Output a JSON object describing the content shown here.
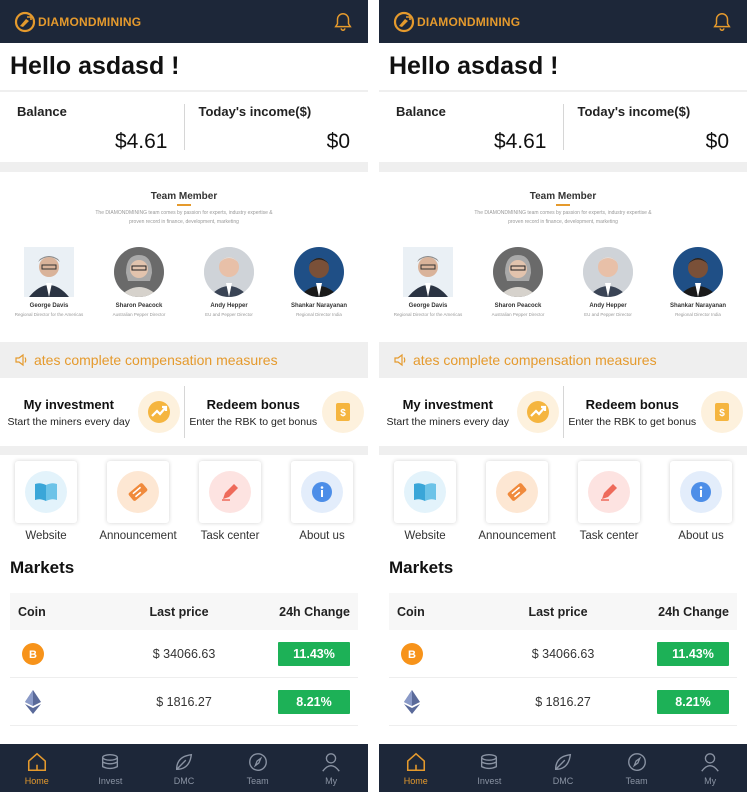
{
  "app": {
    "logo_text": "DIAMONDMINING"
  },
  "greeting": "Hello asdasd !",
  "balance": {
    "label": "Balance",
    "value": "$4.61"
  },
  "income": {
    "label": "Today's income($)",
    "value": "$0"
  },
  "team": {
    "title": "Team Member",
    "description": "The DIAMONDMINING team comes by passion for experts, industry expertise & proven record in finance, development, marketing",
    "members": [
      {
        "name": "George Davis",
        "role": "Regional Director for the Americas"
      },
      {
        "name": "Sharon Peacock",
        "role": "Australian Pepper Director"
      },
      {
        "name": "Andy Hepper",
        "role": "EU and Pepper Director"
      },
      {
        "name": "Shankar Narayanan",
        "role": "Regional Director India"
      }
    ]
  },
  "notice": {
    "text": "ates complete compensation measures",
    "icon": "speaker-icon"
  },
  "actions": {
    "investment": {
      "title": "My investment",
      "subtitle": "Start the miners every day"
    },
    "redeem": {
      "title": "Redeem bonus",
      "subtitle": "Enter the RBK to get bonus"
    }
  },
  "shortcuts": [
    {
      "label": "Website",
      "icon": "book-icon",
      "bg": "#e3f3fb",
      "color": "#3aa6d8"
    },
    {
      "label": "Announcement",
      "icon": "ticket-icon",
      "bg": "#fde7d3",
      "color": "#f08a3c"
    },
    {
      "label": "Task center",
      "icon": "pen-icon",
      "bg": "#fde3e1",
      "color": "#ee6a5a"
    },
    {
      "label": "About us",
      "icon": "info-icon",
      "bg": "#e3edfb",
      "color": "#4d8ee8"
    }
  ],
  "markets": {
    "title": "Markets",
    "columns": {
      "coin": "Coin",
      "price": "Last price",
      "change": "24h Change"
    },
    "rows": [
      {
        "coin": "bitcoin",
        "price": "$ 34066.63",
        "change": "11.43%"
      },
      {
        "coin": "ethereum",
        "price": "$ 1816.27",
        "change": "8.21%"
      }
    ]
  },
  "tabs": [
    {
      "label": "Home",
      "icon": "home-icon"
    },
    {
      "label": "Invest",
      "icon": "coins-icon"
    },
    {
      "label": "DMC",
      "icon": "leaf-icon"
    },
    {
      "label": "Team",
      "icon": "compass-icon"
    },
    {
      "label": "My",
      "icon": "user-icon"
    }
  ],
  "colors": {
    "accent": "#e59a2d",
    "dark": "#1d2739",
    "green": "#1db157"
  }
}
